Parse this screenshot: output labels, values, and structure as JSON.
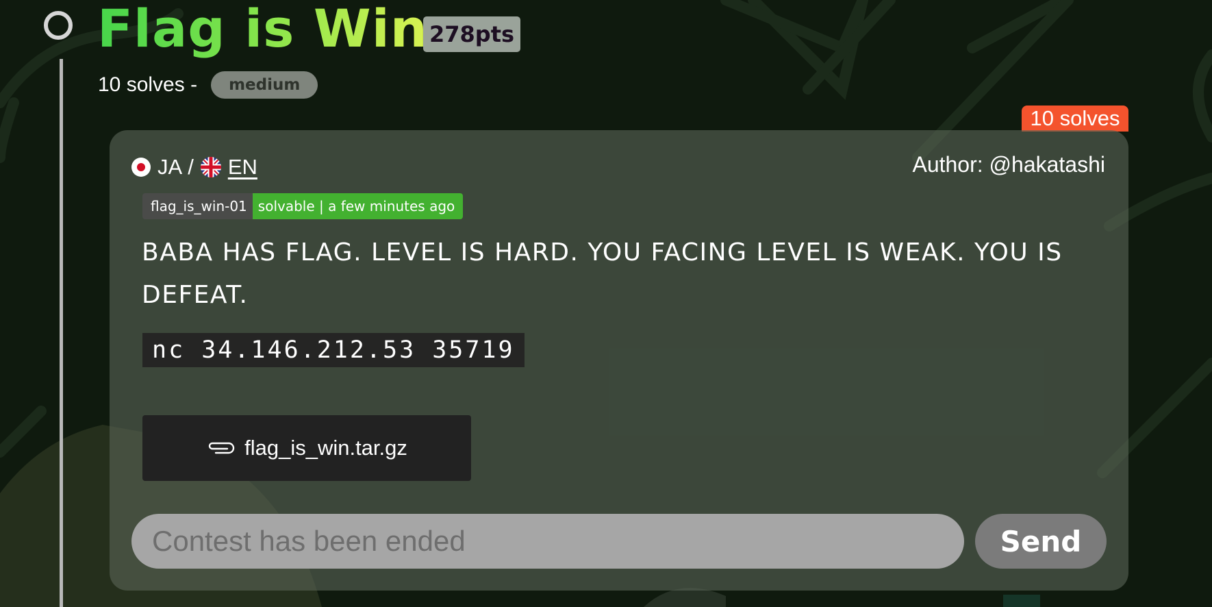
{
  "challenge": {
    "title": "Flag is Win",
    "points": "278pts",
    "solves_text": "10 solves -",
    "difficulty": "medium",
    "solves_ribbon": "10 solves"
  },
  "card": {
    "lang_ja": "JA",
    "lang_sep": "/",
    "lang_en": "EN",
    "author": "Author: @hakatashi",
    "status_id": "flag_is_win-01",
    "status_text": "solvable | a few minutes ago",
    "description": "BABA HAS FLAG. LEVEL IS HARD. YOU FACING LEVEL IS WEAK. YOU IS DEFEAT.",
    "command": "nc 34.146.212.53 35719",
    "attachment_name": "flag_is_win.tar.gz",
    "attachment_icon": "paperclip-icon",
    "flag_placeholder": "Contest has been ended",
    "send_label": "Send"
  },
  "colors": {
    "background": "#0f1a0e",
    "title_gradient_start": "#47d54b",
    "title_gradient_end": "#d8f252",
    "ribbon": "#f4532d",
    "status_green": "#43b130"
  }
}
